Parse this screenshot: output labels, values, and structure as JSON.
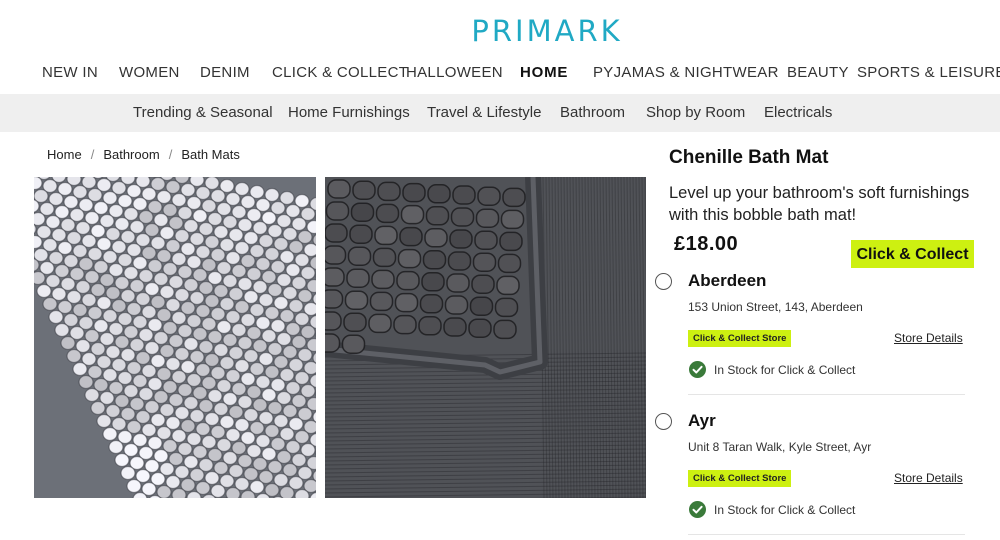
{
  "brand": {
    "logo_text": "PRIMARK",
    "color": "#20a9c4"
  },
  "main_nav": [
    {
      "label": "NEW IN"
    },
    {
      "label": "WOMEN"
    },
    {
      "label": "DENIM"
    },
    {
      "label": "CLICK & COLLECT"
    },
    {
      "label": "HALLOWEEN"
    },
    {
      "label": "HOME",
      "active": true
    },
    {
      "label": "PYJAMAS & NIGHTWEAR"
    },
    {
      "label": "BEAUTY"
    },
    {
      "label": "SPORTS & LEISURE"
    }
  ],
  "sub_nav": [
    {
      "label": "Trending & Seasonal"
    },
    {
      "label": "Home Furnishings"
    },
    {
      "label": "Travel & Lifestyle"
    },
    {
      "label": "Bathroom"
    },
    {
      "label": "Shop by Room"
    },
    {
      "label": "Electricals"
    }
  ],
  "breadcrumb": [
    {
      "label": "Home"
    },
    {
      "label": "Bathroom"
    },
    {
      "label": "Bath Mats"
    }
  ],
  "breadcrumb_separator": "/",
  "product": {
    "title": "Chenille Bath Mat",
    "description": "Level up your bathroom's soft furnishings with this bobble bath mat!",
    "price": "£18.00",
    "cta_label": "Click & Collect"
  },
  "stores": [
    {
      "name": "Aberdeen",
      "address": "153 Union Street, 143, Aberdeen",
      "badge": "Click & Collect Store",
      "details_label": "Store Details",
      "stock_status": "In Stock for Click & Collect"
    },
    {
      "name": "Ayr",
      "address": "Unit 8 Taran Walk, Kyle Street, Ayr",
      "badge": "Click & Collect Store",
      "details_label": "Store Details",
      "stock_status": "In Stock for Click & Collect"
    }
  ],
  "colors": {
    "accent_lime": "#cdf011",
    "stock_green": "#3a7a3a",
    "subnav_bg": "#efefef"
  },
  "icons": {
    "radio": "radio-button-icon",
    "stock": "check-circle-icon"
  }
}
